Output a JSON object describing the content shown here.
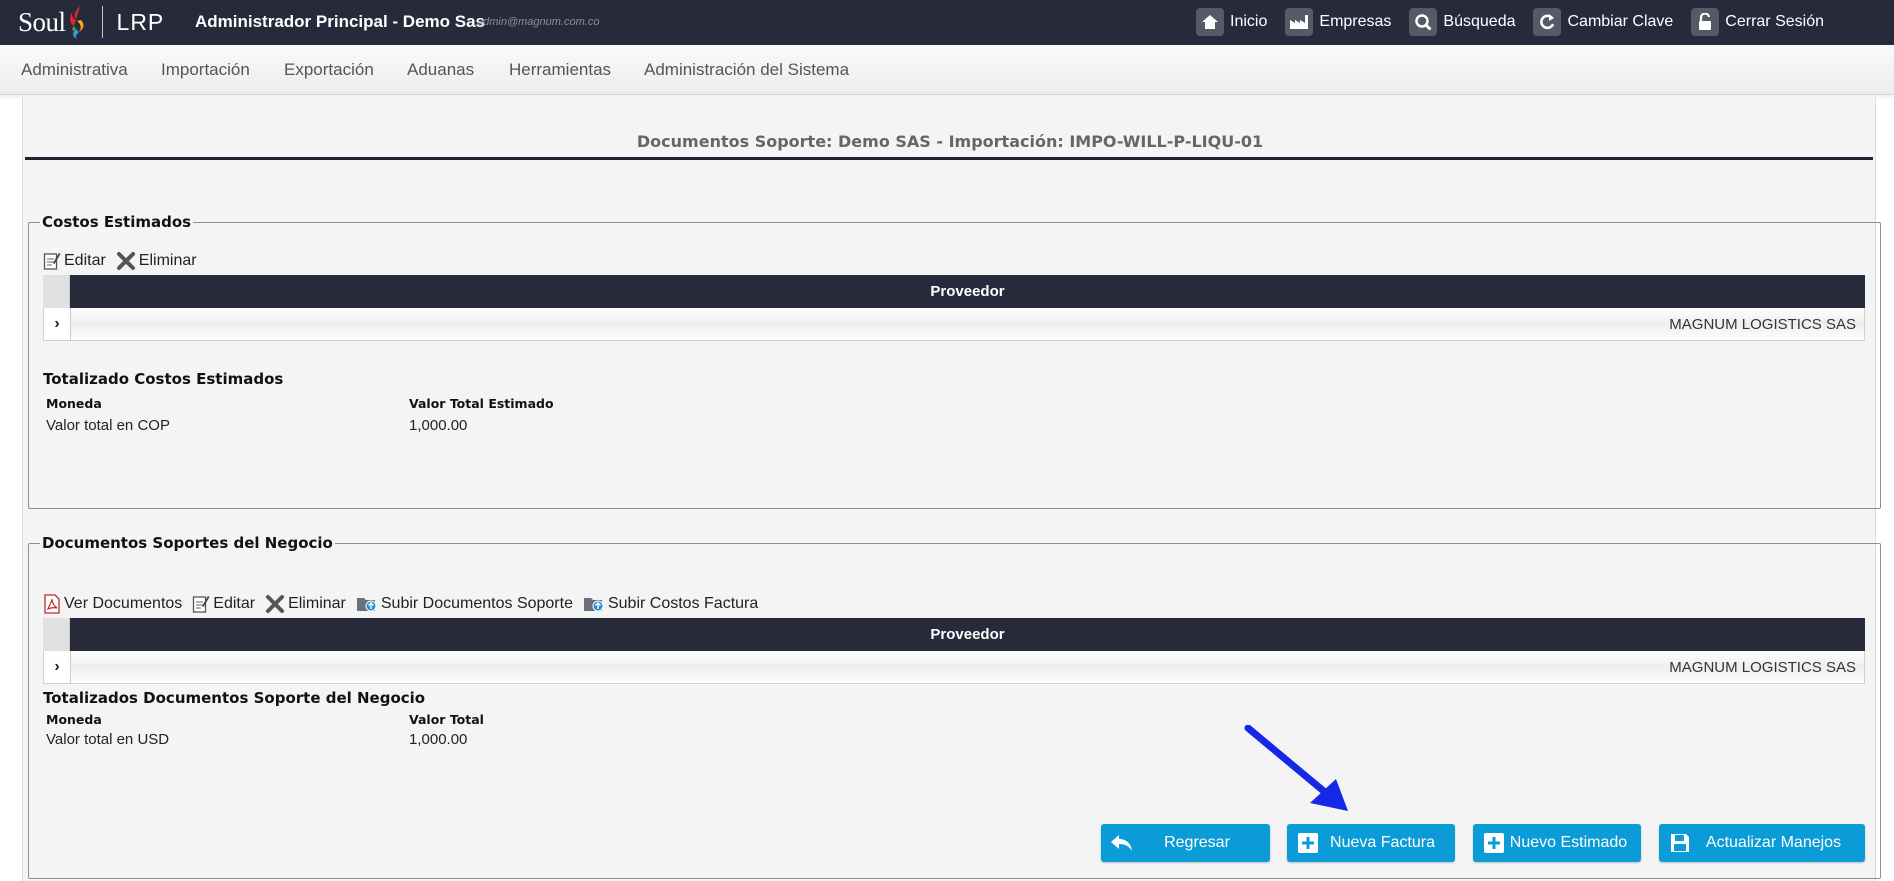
{
  "header": {
    "logo_soul": "Soul",
    "logo_lrp": "LRP",
    "title": "Administrador Principal - Demo Sas",
    "email": "admin@magnum.com.co",
    "nav": [
      {
        "label": "Inicio",
        "icon": "home-icon"
      },
      {
        "label": "Empresas",
        "icon": "factory-icon"
      },
      {
        "label": "Búsqueda",
        "icon": "search-icon"
      },
      {
        "label": "Cambiar Clave",
        "icon": "refresh-icon"
      },
      {
        "label": "Cerrar Sesión",
        "icon": "unlock-icon"
      }
    ]
  },
  "menu": {
    "items": [
      "Administrativa",
      "Importación",
      "Exportación",
      "Aduanas",
      "Herramientas",
      "Administración del Sistema"
    ]
  },
  "page": {
    "title": "Documentos Soporte: Demo SAS - Importación: IMPO-WILL-P-LIQU-01"
  },
  "costos": {
    "legend": "Costos Estimados",
    "toolbar": {
      "edit": "Editar",
      "delete": "Eliminar"
    },
    "grid": {
      "header": "Proveedor",
      "rows": [
        "MAGNUM LOGISTICS SAS"
      ]
    },
    "totals_title": "Totalizado Costos Estimados",
    "col_moneda": "Moneda",
    "col_valor": "Valor Total Estimado",
    "row_moneda": "Valor total en COP",
    "row_valor": "1,000.00"
  },
  "documentos": {
    "legend": "Documentos Soportes del Negocio",
    "toolbar": {
      "view": "Ver Documentos",
      "edit": "Editar",
      "delete": "Eliminar",
      "upload_docs": "Subir Documentos Soporte",
      "upload_costs": "Subir Costos Factura"
    },
    "grid": {
      "header": "Proveedor",
      "rows": [
        "MAGNUM LOGISTICS SAS"
      ]
    },
    "totals_title": "Totalizados Documentos Soporte del Negocio",
    "col_moneda": "Moneda",
    "col_valor": "Valor Total",
    "row_moneda": "Valor total en USD",
    "row_valor": "1,000.00"
  },
  "buttons": {
    "back": "Regresar",
    "new_invoice": "Nueva Factura",
    "new_estimate": "Nuevo Estimado",
    "update": "Actualizar Manejos"
  },
  "colors": {
    "topbar": "#272a3a",
    "button": "#0b9bd6",
    "annotation_arrow": "#1428e6"
  }
}
